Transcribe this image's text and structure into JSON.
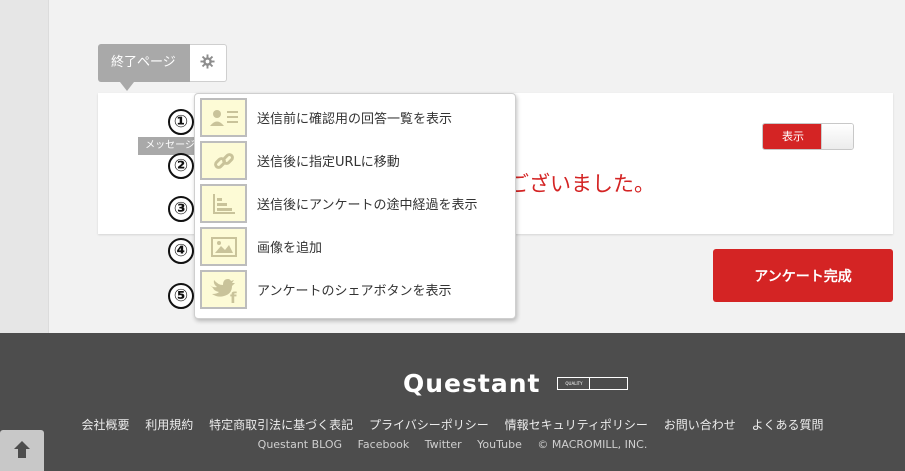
{
  "editor": {
    "tab_label": "終了ページ",
    "message_label": "メッセージ",
    "thanks_text": "ございました。",
    "toggle_label": "表示",
    "complete_button": "アンケート完成"
  },
  "dropdown": {
    "items": [
      {
        "number": "①",
        "label": "送信前に確認用の回答一覧を表示",
        "icon": "person-list-icon"
      },
      {
        "number": "②",
        "label": "送信後に指定URLに移動",
        "icon": "link-icon"
      },
      {
        "number": "③",
        "label": "送信後にアンケートの途中経過を表示",
        "icon": "bar-chart-icon"
      },
      {
        "number": "④",
        "label": "画像を追加",
        "icon": "image-icon"
      },
      {
        "number": "⑤",
        "label": "アンケートのシェアボタンを表示",
        "icon": "twitter-facebook-icon"
      }
    ]
  },
  "footer": {
    "logo": "Questant",
    "quality_badge_left": "QUALITY",
    "quality_badge_right": "",
    "links_row1": [
      "会社概要",
      "利用規約",
      "特定商取引法に基づく表記",
      "プライバシーポリシー",
      "情報セキュリティポリシー",
      "お問い合わせ",
      "よくある質問"
    ],
    "links_row2": [
      "Questant BLOG",
      "Facebook",
      "Twitter",
      "YouTube",
      "© MACROMILL, INC."
    ]
  },
  "colors": {
    "accent": "#d42424",
    "footer_bg": "#4d4d4d",
    "icon_bg": "#fdfbd6"
  }
}
